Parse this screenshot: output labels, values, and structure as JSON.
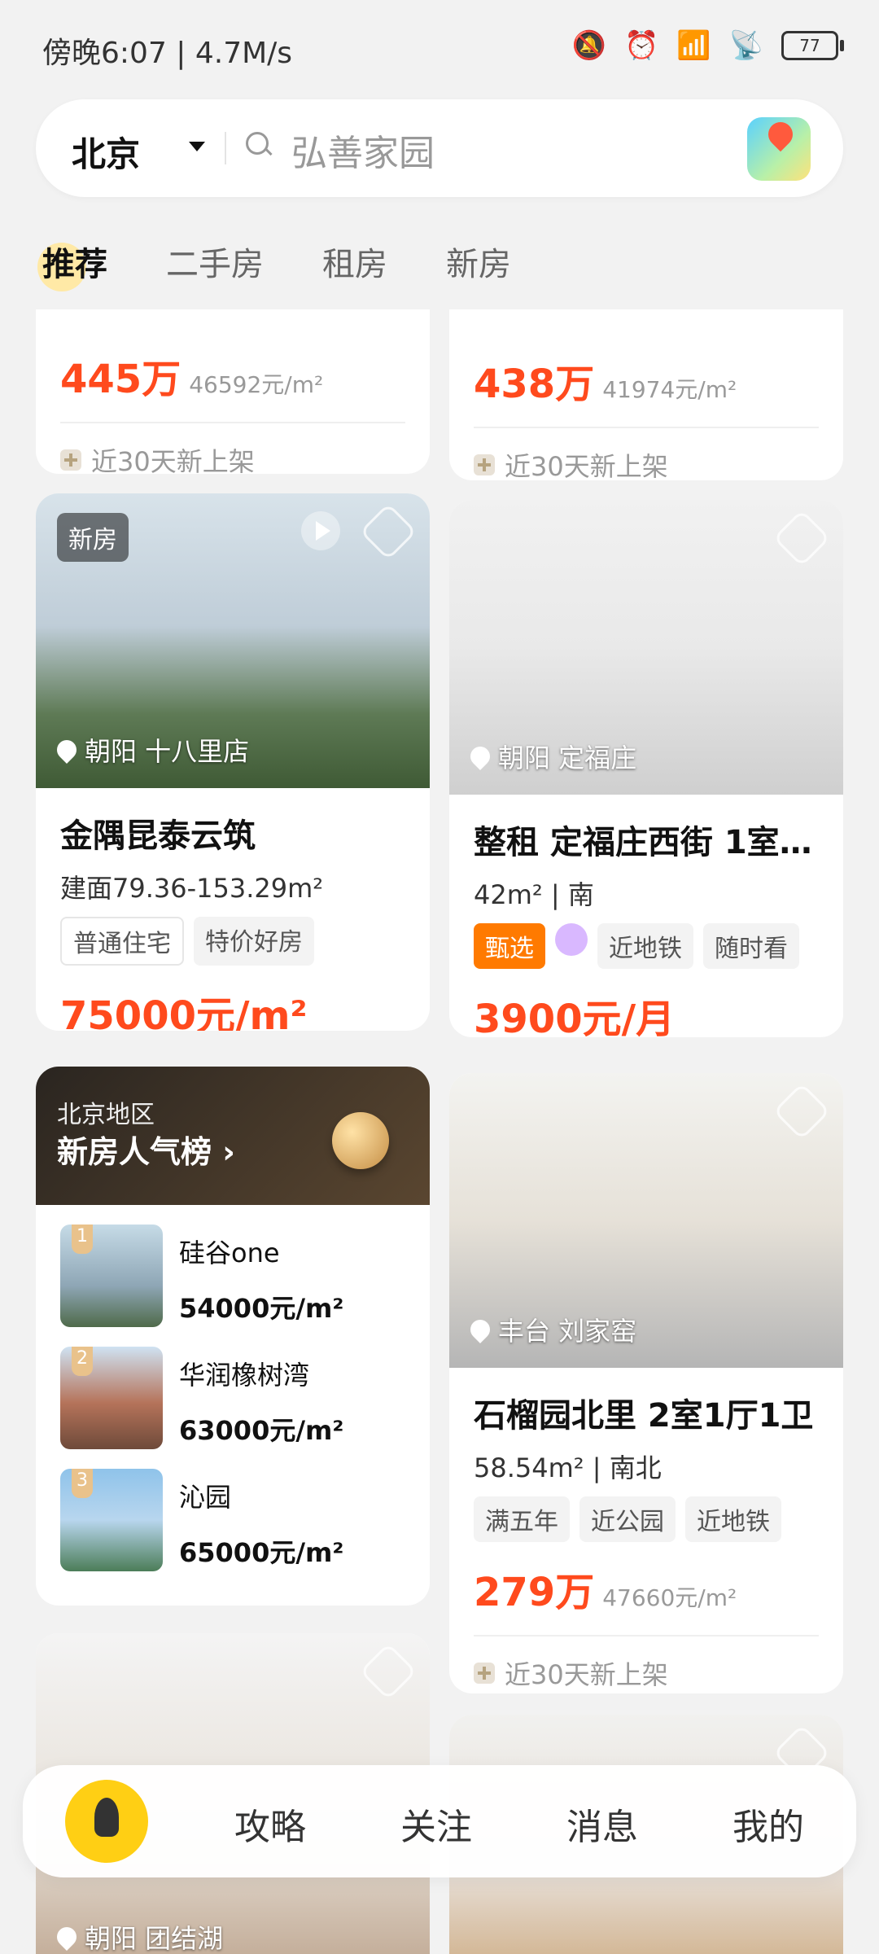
{
  "status": {
    "time": "傍晚6:07 | 4.7M/s",
    "battery": "77"
  },
  "search": {
    "city": "北京",
    "placeholder": "弘善家园"
  },
  "tabs": [
    "推荐",
    "二手房",
    "租房",
    "新房"
  ],
  "cards": {
    "top_left": {
      "price": "445万",
      "unit": "46592元/m²",
      "recent": "近30天新上架"
    },
    "top_right": {
      "price": "438万",
      "unit": "41974元/m²",
      "recent": "近30天新上架"
    },
    "new_home": {
      "badge": "新房",
      "location": "朝阳 十八里店",
      "title": "金隅昆泰云筑",
      "area": "建面79.36-153.29m²",
      "tags": [
        "普通住宅",
        "特价好房"
      ],
      "price": "75000元/m²"
    },
    "rent": {
      "location": "朝阳 定福庄",
      "title": "整租 定福庄西街 1室…",
      "area": "42m² | 南",
      "tags": [
        "甄选",
        "",
        "近地铁",
        "随时看"
      ],
      "price": "3900元/月"
    },
    "ranking": {
      "region": "北京地区",
      "title": "新房人气榜 ›",
      "items": [
        {
          "rank": "1",
          "name": "硅谷one",
          "price": "54000元/m²"
        },
        {
          "rank": "2",
          "name": "华润橡树湾",
          "price": "63000元/m²"
        },
        {
          "rank": "3",
          "name": "沁园",
          "price": "65000元/m²"
        }
      ]
    },
    "shiliuyuan": {
      "location": "丰台 刘家窑",
      "title": "石榴园北里 2室1厅1卫",
      "area": "58.54m² | 南北",
      "tags": [
        "满五年",
        "近公园",
        "近地铁"
      ],
      "price": "279万",
      "unit": "47660元/m²",
      "recent": "近30天新上架"
    },
    "bottom_left": {
      "location": "朝阳 团结湖"
    }
  },
  "bottom_nav": [
    "攻略",
    "关注",
    "消息",
    "我的"
  ]
}
